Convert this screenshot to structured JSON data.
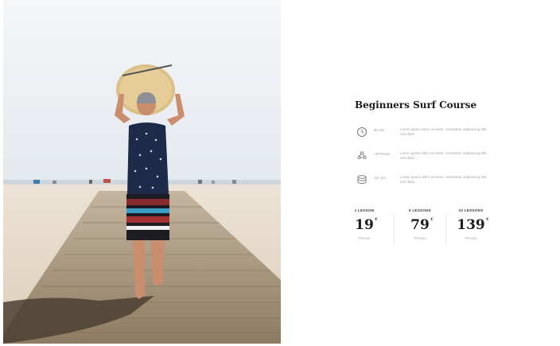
{
  "course": {
    "title": "Beginners Surf Course"
  },
  "features": [
    {
      "icon": "clock-icon",
      "label": "90 min",
      "description": "Lorem ipsum dolor sit amet, consetetur sadipscing elitr, sed diam"
    },
    {
      "icon": "people-icon",
      "label": "+8 Person",
      "description": "Lorem ipsum dolor sit amet, consetetur sadipscing elitr, sed diam"
    },
    {
      "icon": "layers-icon",
      "label": "12+ yrs",
      "description": "Lorem ipsum dolor sit amet, consetetur sadipscing elitr, sed diam"
    }
  ],
  "pricing": [
    {
      "label": "1 LESSON",
      "price": "19",
      "currency": "€",
      "unit": "/Person"
    },
    {
      "label": "5 LESSONS",
      "price": "79",
      "currency": "€",
      "unit": "/Person"
    },
    {
      "label": "10 LESSONS",
      "price": "139",
      "currency": "€",
      "unit": "/Person"
    }
  ],
  "colors": {
    "sky": "#e9edf2",
    "sand": "#e8dccb",
    "boardwalk": "#a8957c",
    "accent_text": "#1d1d1d"
  }
}
